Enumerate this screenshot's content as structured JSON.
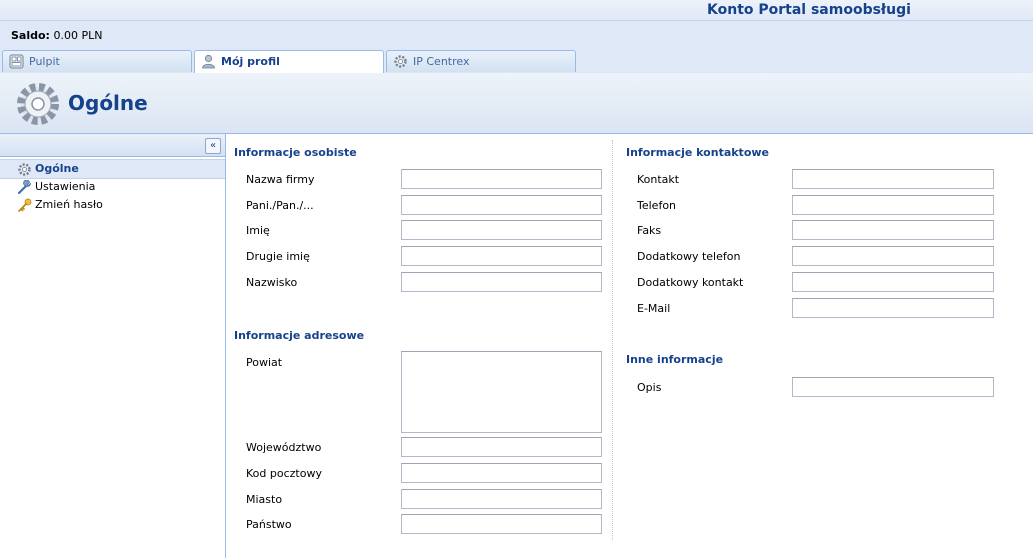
{
  "header": {
    "portal_title": "Konto Portal samoobsługi"
  },
  "saldo": {
    "label": "Saldo:",
    "value": "0.00 PLN"
  },
  "tabs": [
    {
      "label": "Pulpit",
      "icon": "dashboard-icon"
    },
    {
      "label": "Mój profil",
      "icon": "user-icon"
    },
    {
      "label": "IP Centrex",
      "icon": "gear-icon"
    }
  ],
  "page": {
    "title": "Ogólne",
    "icon": "gear-icon"
  },
  "sidebar": {
    "collapse_label": "«",
    "items": [
      {
        "label": "Ogólne",
        "icon": "gear-icon"
      },
      {
        "label": "Ustawienia",
        "icon": "wrench-icon"
      },
      {
        "label": "Zmień hasło",
        "icon": "key-icon"
      }
    ]
  },
  "form": {
    "personal": {
      "title": "Informacje osobiste",
      "fields": [
        {
          "label": "Nazwa firmy",
          "value": ""
        },
        {
          "label": "Pani./Pan./...",
          "value": ""
        },
        {
          "label": "Imię",
          "value": ""
        },
        {
          "label": "Drugie imię",
          "value": ""
        },
        {
          "label": "Nazwisko",
          "value": ""
        }
      ]
    },
    "address": {
      "title": "Informacje adresowe",
      "fields": [
        {
          "label": "Powiat",
          "value": ""
        },
        {
          "label": "Województwo",
          "value": ""
        },
        {
          "label": "Kod pocztowy",
          "value": ""
        },
        {
          "label": "Miasto",
          "value": ""
        },
        {
          "label": "Państwo",
          "value": ""
        }
      ]
    },
    "contact": {
      "title": "Informacje kontaktowe",
      "fields": [
        {
          "label": "Kontakt",
          "value": ""
        },
        {
          "label": "Telefon",
          "value": ""
        },
        {
          "label": "Faks",
          "value": ""
        },
        {
          "label": "Dodatkowy telefon",
          "value": ""
        },
        {
          "label": "Dodatkowy kontakt",
          "value": ""
        },
        {
          "label": "E-Mail",
          "value": ""
        }
      ]
    },
    "other": {
      "title": "Inne informacje",
      "fields": [
        {
          "label": "Opis",
          "value": ""
        }
      ]
    }
  },
  "colors": {
    "accent": "#15428b",
    "panel": "#dfe8f6",
    "border": "#99bbe8"
  }
}
